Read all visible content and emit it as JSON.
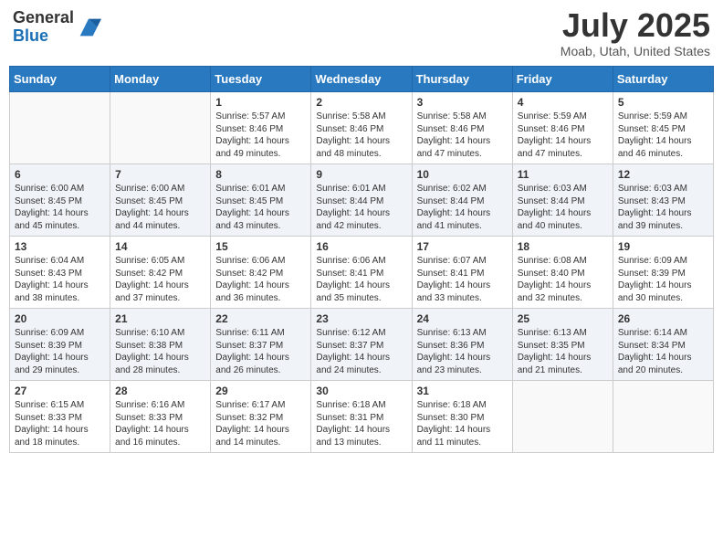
{
  "header": {
    "logo_general": "General",
    "logo_blue": "Blue",
    "month_title": "July 2025",
    "location": "Moab, Utah, United States"
  },
  "days_of_week": [
    "Sunday",
    "Monday",
    "Tuesday",
    "Wednesday",
    "Thursday",
    "Friday",
    "Saturday"
  ],
  "weeks": [
    [
      {
        "day": "",
        "info": ""
      },
      {
        "day": "",
        "info": ""
      },
      {
        "day": "1",
        "info": "Sunrise: 5:57 AM\nSunset: 8:46 PM\nDaylight: 14 hours and 49 minutes."
      },
      {
        "day": "2",
        "info": "Sunrise: 5:58 AM\nSunset: 8:46 PM\nDaylight: 14 hours and 48 minutes."
      },
      {
        "day": "3",
        "info": "Sunrise: 5:58 AM\nSunset: 8:46 PM\nDaylight: 14 hours and 47 minutes."
      },
      {
        "day": "4",
        "info": "Sunrise: 5:59 AM\nSunset: 8:46 PM\nDaylight: 14 hours and 47 minutes."
      },
      {
        "day": "5",
        "info": "Sunrise: 5:59 AM\nSunset: 8:45 PM\nDaylight: 14 hours and 46 minutes."
      }
    ],
    [
      {
        "day": "6",
        "info": "Sunrise: 6:00 AM\nSunset: 8:45 PM\nDaylight: 14 hours and 45 minutes."
      },
      {
        "day": "7",
        "info": "Sunrise: 6:00 AM\nSunset: 8:45 PM\nDaylight: 14 hours and 44 minutes."
      },
      {
        "day": "8",
        "info": "Sunrise: 6:01 AM\nSunset: 8:45 PM\nDaylight: 14 hours and 43 minutes."
      },
      {
        "day": "9",
        "info": "Sunrise: 6:01 AM\nSunset: 8:44 PM\nDaylight: 14 hours and 42 minutes."
      },
      {
        "day": "10",
        "info": "Sunrise: 6:02 AM\nSunset: 8:44 PM\nDaylight: 14 hours and 41 minutes."
      },
      {
        "day": "11",
        "info": "Sunrise: 6:03 AM\nSunset: 8:44 PM\nDaylight: 14 hours and 40 minutes."
      },
      {
        "day": "12",
        "info": "Sunrise: 6:03 AM\nSunset: 8:43 PM\nDaylight: 14 hours and 39 minutes."
      }
    ],
    [
      {
        "day": "13",
        "info": "Sunrise: 6:04 AM\nSunset: 8:43 PM\nDaylight: 14 hours and 38 minutes."
      },
      {
        "day": "14",
        "info": "Sunrise: 6:05 AM\nSunset: 8:42 PM\nDaylight: 14 hours and 37 minutes."
      },
      {
        "day": "15",
        "info": "Sunrise: 6:06 AM\nSunset: 8:42 PM\nDaylight: 14 hours and 36 minutes."
      },
      {
        "day": "16",
        "info": "Sunrise: 6:06 AM\nSunset: 8:41 PM\nDaylight: 14 hours and 35 minutes."
      },
      {
        "day": "17",
        "info": "Sunrise: 6:07 AM\nSunset: 8:41 PM\nDaylight: 14 hours and 33 minutes."
      },
      {
        "day": "18",
        "info": "Sunrise: 6:08 AM\nSunset: 8:40 PM\nDaylight: 14 hours and 32 minutes."
      },
      {
        "day": "19",
        "info": "Sunrise: 6:09 AM\nSunset: 8:39 PM\nDaylight: 14 hours and 30 minutes."
      }
    ],
    [
      {
        "day": "20",
        "info": "Sunrise: 6:09 AM\nSunset: 8:39 PM\nDaylight: 14 hours and 29 minutes."
      },
      {
        "day": "21",
        "info": "Sunrise: 6:10 AM\nSunset: 8:38 PM\nDaylight: 14 hours and 28 minutes."
      },
      {
        "day": "22",
        "info": "Sunrise: 6:11 AM\nSunset: 8:37 PM\nDaylight: 14 hours and 26 minutes."
      },
      {
        "day": "23",
        "info": "Sunrise: 6:12 AM\nSunset: 8:37 PM\nDaylight: 14 hours and 24 minutes."
      },
      {
        "day": "24",
        "info": "Sunrise: 6:13 AM\nSunset: 8:36 PM\nDaylight: 14 hours and 23 minutes."
      },
      {
        "day": "25",
        "info": "Sunrise: 6:13 AM\nSunset: 8:35 PM\nDaylight: 14 hours and 21 minutes."
      },
      {
        "day": "26",
        "info": "Sunrise: 6:14 AM\nSunset: 8:34 PM\nDaylight: 14 hours and 20 minutes."
      }
    ],
    [
      {
        "day": "27",
        "info": "Sunrise: 6:15 AM\nSunset: 8:33 PM\nDaylight: 14 hours and 18 minutes."
      },
      {
        "day": "28",
        "info": "Sunrise: 6:16 AM\nSunset: 8:33 PM\nDaylight: 14 hours and 16 minutes."
      },
      {
        "day": "29",
        "info": "Sunrise: 6:17 AM\nSunset: 8:32 PM\nDaylight: 14 hours and 14 minutes."
      },
      {
        "day": "30",
        "info": "Sunrise: 6:18 AM\nSunset: 8:31 PM\nDaylight: 14 hours and 13 minutes."
      },
      {
        "day": "31",
        "info": "Sunrise: 6:18 AM\nSunset: 8:30 PM\nDaylight: 14 hours and 11 minutes."
      },
      {
        "day": "",
        "info": ""
      },
      {
        "day": "",
        "info": ""
      }
    ]
  ]
}
